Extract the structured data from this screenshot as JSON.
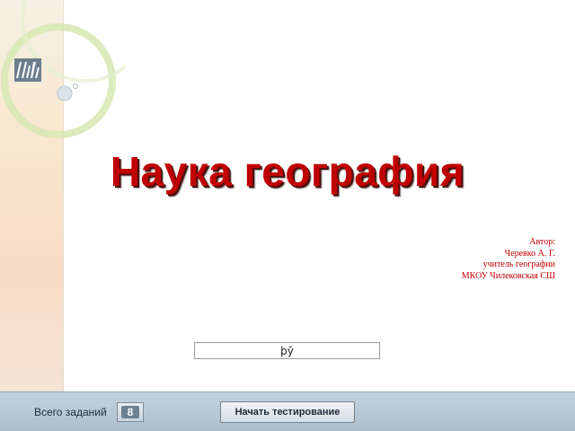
{
  "slide": {
    "title": "Наука география",
    "author_lines": [
      "Автор:",
      "Черевко А. Г.",
      "учитель географии",
      "МКОУ Чилековская СШ"
    ]
  },
  "input": {
    "value": "þў"
  },
  "footer": {
    "total_label": "Всего заданий",
    "total_count": "8",
    "start_label": "Начать тестирование"
  },
  "colors": {
    "title": "#c00000",
    "bar": "#b7c7d4"
  },
  "icons": {
    "slide_logo": "barcode-logo-icon"
  }
}
